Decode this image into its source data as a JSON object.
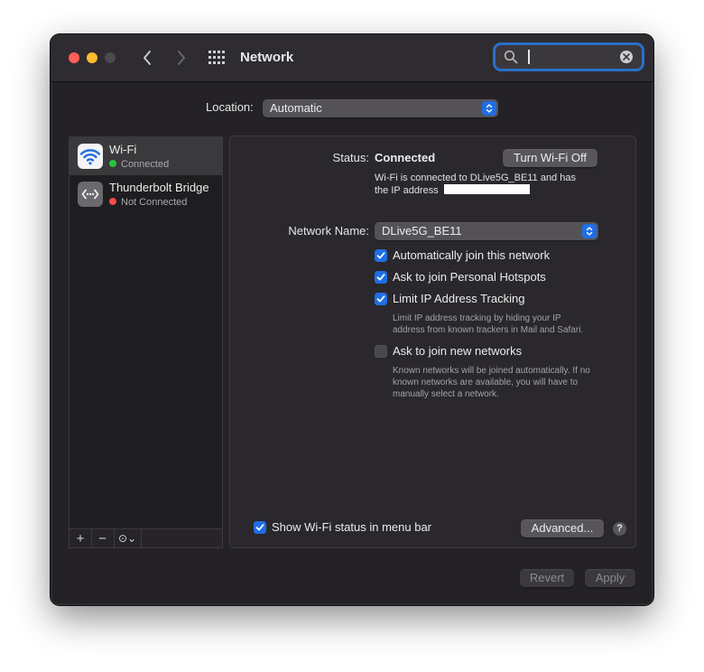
{
  "window": {
    "title": "Network",
    "search": {
      "value": "",
      "placeholder": ""
    }
  },
  "location": {
    "label": "Location:",
    "value": "Automatic"
  },
  "sidebar": {
    "items": [
      {
        "name": "Wi-Fi",
        "status": "Connected",
        "status_color": "#2ac33f",
        "icon": "wifi-icon",
        "selected": true
      },
      {
        "name": "Thunderbolt Bridge",
        "status": "Not Connected",
        "status_color": "#fa4a47",
        "icon": "thunderbolt-bridge-icon",
        "selected": false
      }
    ],
    "toolbar": {
      "add": "+",
      "remove": "−",
      "action": "⊙⌄"
    }
  },
  "detail": {
    "status_label": "Status:",
    "status_value": "Connected",
    "toggle_button": "Turn Wi-Fi Off",
    "status_desc_line1": "Wi-Fi is connected to DLive5G_BE11 and has",
    "status_desc_line2": "the IP address",
    "network_name_label": "Network Name:",
    "network_name_value": "DLive5G_BE11",
    "options": [
      {
        "label": "Automatically join this network",
        "checked": true
      },
      {
        "label": "Ask to join Personal Hotspots",
        "checked": true
      },
      {
        "label": "Limit IP Address Tracking",
        "checked": true
      },
      {
        "label": "Ask to join new networks",
        "checked": false
      }
    ],
    "limit_hint_line1": "Limit IP address tracking by hiding your IP",
    "limit_hint_line2": "address from known trackers in Mail and Safari.",
    "new_hint_line1": "Known networks will be joined automatically. If no",
    "new_hint_line2": "known networks are available, you will have to",
    "new_hint_line3": "manually select a network.",
    "menubar_option": {
      "label": "Show Wi-Fi status in menu bar",
      "checked": true
    },
    "advanced_button": "Advanced...",
    "help": "?"
  },
  "footer": {
    "revert": "Revert",
    "apply": "Apply"
  },
  "colors": {
    "accent": "#1f6ee6",
    "window_bg": "#242226",
    "close": "#fe5f57",
    "minimize": "#febc2e"
  }
}
